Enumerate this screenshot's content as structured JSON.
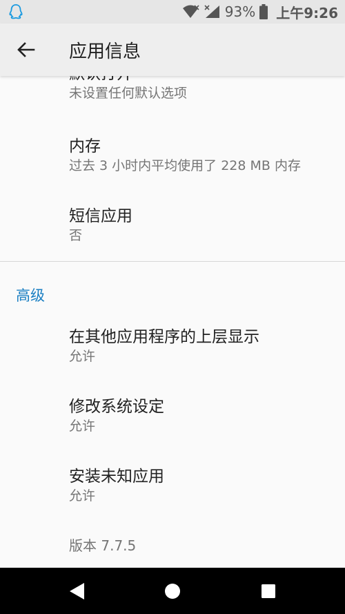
{
  "status_bar": {
    "battery_percent": "93%",
    "time": "上午9:26",
    "icons": [
      "qq-icon",
      "wifi-icon",
      "signal-icon",
      "battery-icon"
    ]
  },
  "app_bar": {
    "title": "应用信息",
    "back_icon": "arrow-back-icon"
  },
  "items": [
    {
      "title": "默认打开",
      "subtitle": "未设置任何默认选项"
    },
    {
      "title": "内存",
      "subtitle": "过去 3 小时内平均使用了 228 MB 内存"
    },
    {
      "title": "短信应用",
      "subtitle": "否"
    },
    {
      "title": "在其他应用程序的上层显示",
      "subtitle": "允许"
    },
    {
      "title": "修改系统设定",
      "subtitle": "允许"
    },
    {
      "title": "安装未知应用",
      "subtitle": "允许"
    }
  ],
  "section_header": "高级",
  "version": "版本 7.7.5",
  "colors": {
    "accent": "#1a7fc3",
    "status_bar": "#e6e6e6",
    "app_bar": "#eeeeee",
    "nav_bar": "#000000"
  }
}
